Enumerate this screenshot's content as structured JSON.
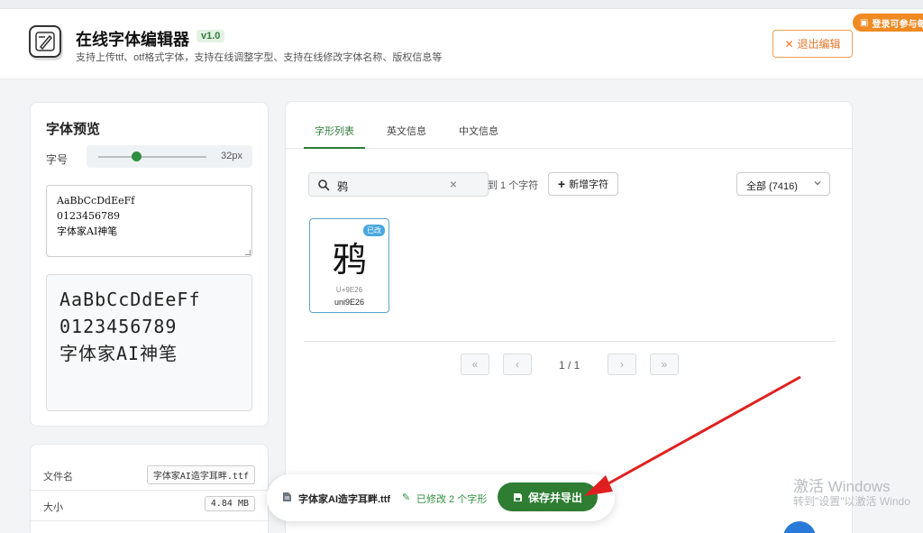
{
  "header": {
    "title": "在线字体编辑器",
    "version": "v1.0",
    "subtitle": "支持上传ttf、otf格式字体，支持在线调整字型、支持在线修改字体名称、版权信息等",
    "exit_label": "退出编辑",
    "promo_label": "登录可参与每"
  },
  "preview": {
    "title": "字体预览",
    "size_label": "字号",
    "size_value_text": "32px",
    "slider_fraction": 0.35,
    "sample_text": "AaBbCcDdEeFf\n0123456789\n字体家AI神笔",
    "render_text": "AaBbCcDdEeFf\n0123456789\n字体家AI神笔"
  },
  "info": {
    "rows": [
      {
        "label": "文件名",
        "value": "字体家AI造字耳畔.ttf"
      },
      {
        "label": "大小",
        "value": "4.84 MB"
      }
    ]
  },
  "tabs": [
    {
      "label": "字形列表"
    },
    {
      "label": "英文信息"
    },
    {
      "label": "中文信息"
    }
  ],
  "toolbar": {
    "search_value": "鸦",
    "count_text": "到 1 个字符",
    "add_label": "新增字符",
    "filter_label": "全部 (7416)"
  },
  "glyph": {
    "badge": "已改",
    "char": "鸦",
    "code": "U+9E26",
    "name": "uni9E26"
  },
  "pagination": {
    "first": "«",
    "prev": "‹",
    "page_text": "1 / 1",
    "next": "›",
    "last": "»"
  },
  "savebar": {
    "file_name": "字体家AI造字耳畔.ttf",
    "modified_text": "已修改 2 个字形",
    "save_label": "保存并导出"
  },
  "watermark": {
    "line1": "激活 Windows",
    "line2": "转到\"设置\"以激活 Windo"
  },
  "colors": {
    "accent_green": "#2e7d32",
    "exit_orange": "#e8772a",
    "badge_blue": "#49a7e0",
    "arrow_red": "#e02020"
  }
}
